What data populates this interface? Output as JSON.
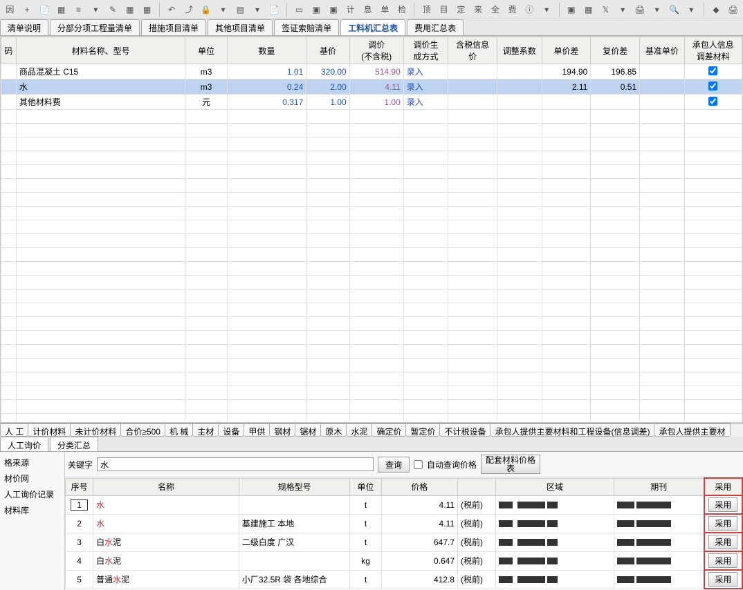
{
  "toolbar_icons": [
    "因",
    "+",
    "📄",
    "▦",
    "≡",
    "▾",
    "✎",
    "▦",
    "▦",
    "|",
    "↶",
    "⤴",
    "🔒",
    "▾",
    "▤",
    "▾",
    "📄",
    "|",
    "▭",
    "▣",
    "▣",
    "计",
    "息",
    "单",
    "检",
    "|",
    "顶",
    "目",
    "定",
    "来",
    "全",
    "费",
    "ⓘ",
    "▾",
    "|",
    "▣",
    "▦",
    "𝕏",
    "▾",
    "🖨",
    "▾",
    "🔍",
    "▾",
    "|",
    "◆",
    "🖨"
  ],
  "tabs": [
    "清单说明",
    "分部分项工程量清单",
    "措施项目清单",
    "其他项目清单",
    "签证索赔清单",
    "工料机汇总表",
    "费用汇总表"
  ],
  "active_tab": 5,
  "main_headers": [
    "码",
    "材料名称、型号",
    "单位",
    "数量",
    "基价",
    "调价\n(不含税)",
    "调价生\n成方式",
    "含税信息\n价",
    "调整系数",
    "单价差",
    "复价差",
    "基准单价",
    "承包人信息\n调差材料"
  ],
  "main_rows": [
    {
      "name": "商品混凝土 C15",
      "unit": "m3",
      "qty": "1.01",
      "base": "320.00",
      "adj": "514.90",
      "mode": "录入",
      "tax": "",
      "coef": "",
      "udiff": "194.90",
      "cdiff": "196.85",
      "bench": "",
      "chk": true,
      "sel": false
    },
    {
      "name": "水",
      "unit": "m3",
      "qty": "0.24",
      "base": "2.00",
      "adj": "4.11",
      "mode": "录入",
      "tax": "",
      "coef": "",
      "udiff": "2.11",
      "cdiff": "0.51",
      "bench": "",
      "chk": true,
      "sel": true
    },
    {
      "name": "其他材料费",
      "unit": "元",
      "qty": "0.317",
      "base": "1.00",
      "adj": "1.00",
      "mode": "录入",
      "tax": "",
      "coef": "",
      "udiff": "",
      "cdiff": "",
      "bench": "",
      "chk": true,
      "sel": false
    }
  ],
  "empty_rows": 23,
  "bottom_tabs": [
    "人 工",
    "计价材料",
    "未计价材料",
    "合价≥500",
    "机 械",
    "主材",
    "设备",
    "甲供",
    "钢材",
    "锯材",
    "原木",
    "水泥",
    "确定价",
    "暂定价",
    "不计税设备",
    "承包人提供主要材料和工程设备(信息调差)",
    "承包人提供主要材"
  ],
  "sub_tabs": [
    "人工询价",
    "分类汇总"
  ],
  "tree": [
    "格来源",
    "材价网",
    "人工询价记录",
    "材料库"
  ],
  "search": {
    "label": "关键字",
    "value": "水",
    "query_btn": "查询",
    "auto_label": "自动查询价格",
    "table_btn": "配套材料价格\n表"
  },
  "result_headers": [
    "序号",
    "名称",
    "规格型号",
    "单位",
    "价格",
    "",
    "区域",
    "期刊",
    "采用"
  ],
  "result_rows": [
    {
      "seq": "1",
      "name": "水",
      "spec": "",
      "unit": "t",
      "price": "4.11",
      "tax": "(税前)",
      "btn": "采用",
      "box": true
    },
    {
      "seq": "2",
      "name": "水",
      "spec": "基建施工 本地",
      "unit": "t",
      "price": "4.11",
      "tax": "(税前)",
      "btn": "采用",
      "box": false
    },
    {
      "seq": "3",
      "name": "白水泥",
      "spec": "二级白度 广汉",
      "unit": "t",
      "price": "647.7",
      "tax": "(税前)",
      "btn": "采用",
      "box": false
    },
    {
      "seq": "4",
      "name": "白水泥",
      "spec": "",
      "unit": "kg",
      "price": "0.647",
      "tax": "(税前)",
      "btn": "采用",
      "box": false
    },
    {
      "seq": "5",
      "name": "普通水泥",
      "spec": "小厂32.5R 袋 各地综合",
      "unit": "t",
      "price": "412.8",
      "tax": "(税前)",
      "btn": "采用",
      "box": false
    }
  ]
}
